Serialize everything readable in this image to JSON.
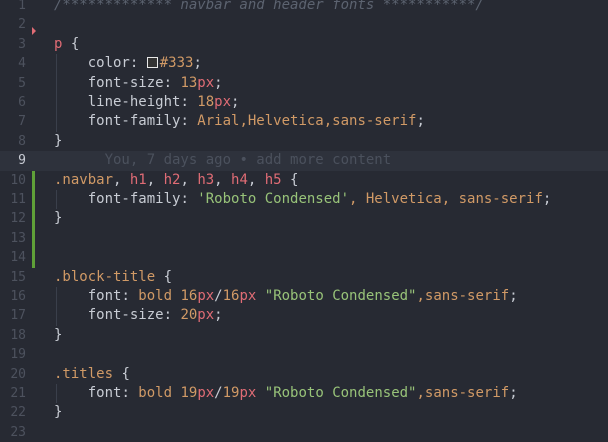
{
  "lines": [
    {
      "n": "1",
      "comment": "/************* navbar and header fonts ***********/"
    },
    {
      "n": "2"
    },
    {
      "n": "3",
      "selector": "p",
      "brace": " {"
    },
    {
      "n": "4",
      "prop": "color",
      "value": "#333",
      "swatch": "#333333"
    },
    {
      "n": "5",
      "prop": "font-size",
      "num": "13",
      "unit": "px"
    },
    {
      "n": "6",
      "prop": "line-height",
      "num": "18",
      "unit": "px"
    },
    {
      "n": "7",
      "prop": "font-family",
      "value": "Arial,Helvetica,sans-serif"
    },
    {
      "n": "8",
      "close": "}"
    },
    {
      "n": "9",
      "blame": "You, 7 days ago • add more content"
    },
    {
      "n": "10"
    },
    {
      "n": "11",
      "prop": "font-family",
      "str": "'Roboto Condensed'",
      "rest": ", Helvetica, sans-serif"
    },
    {
      "n": "12",
      "close": "}"
    },
    {
      "n": "13"
    },
    {
      "n": "14"
    },
    {
      "n": "15",
      "cls": ".block-title",
      "brace": " {"
    },
    {
      "n": "16",
      "prop": "font",
      "kw": "bold",
      "n1": "16",
      "n2": "16",
      "str": "\"Roboto Condensed\"",
      "rest": ",sans-serif"
    },
    {
      "n": "17",
      "prop": "font-size",
      "num": "20",
      "unit": "px"
    },
    {
      "n": "18",
      "close": "}"
    },
    {
      "n": "19"
    },
    {
      "n": "20",
      "cls": ".titles",
      "brace": " {"
    },
    {
      "n": "21",
      "prop": "font",
      "kw": "bold",
      "n1": "19",
      "n2": "19",
      "str": "\"Roboto Condensed\"",
      "rest": ",sans-serif"
    },
    {
      "n": "22",
      "close": "}"
    },
    {
      "n": "23"
    }
  ],
  "line10": {
    "cls": ".navbar",
    "sep": ", ",
    "tags": [
      "h1",
      "h2",
      "h3",
      "h4",
      "h5"
    ],
    "brace": " {"
  },
  "colors": {
    "background": "#272a33",
    "selector": "#e06c75",
    "class": "#d19a66",
    "string": "#98c379",
    "gutter": "#4d525e",
    "git_added": "#5fa038"
  }
}
